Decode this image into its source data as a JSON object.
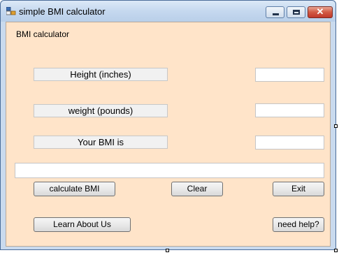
{
  "window": {
    "title": "simple BMI calculator",
    "minimize_icon": "minimize-icon",
    "maximize_icon": "maximize-icon",
    "close_icon": "close-icon",
    "close_glyph": "✕"
  },
  "form": {
    "heading": "BMI calculator",
    "labels": {
      "height": "Height (inches)",
      "weight": "weight (pounds)",
      "bmi": "Your BMI is"
    },
    "inputs": {
      "height_value": "",
      "weight_value": "",
      "bmi_value": "",
      "result_value": ""
    },
    "buttons": {
      "calculate": "calculate BMI",
      "clear": "Clear",
      "exit": "Exit",
      "learn": "Learn About Us",
      "help": "need help?"
    }
  },
  "colors": {
    "form_background": "#ffe4c9",
    "titlebar": "#c5d8ef",
    "close_button": "#c0392b"
  }
}
